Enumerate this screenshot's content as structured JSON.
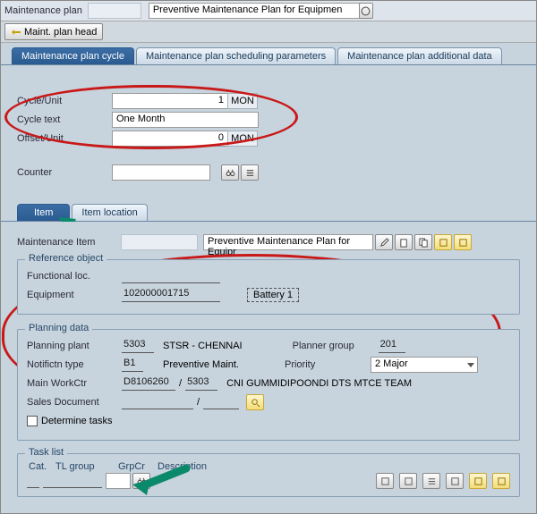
{
  "header": {
    "plan_lbl": "Maintenance plan",
    "plan_code": "",
    "plan_desc": "Preventive Maintenance Plan for Equipmen",
    "head_btn": "Maint. plan head"
  },
  "tabs_main": {
    "cycle": "Maintenance plan cycle",
    "sched": "Maintenance plan scheduling parameters",
    "addl": "Maintenance plan additional data"
  },
  "cycle": {
    "cycle_unit_lbl": "Cycle/Unit",
    "cycle_val": "1",
    "cycle_unit": "MON",
    "cycle_text_lbl": "Cycle text",
    "cycle_text": "One Month",
    "offset_lbl": "Offset/Unit",
    "offset_val": "0",
    "offset_unit": "MON",
    "counter_lbl": "Counter",
    "counter_val": ""
  },
  "tabs_item": {
    "item": "Item",
    "item_loc": "Item location"
  },
  "maint_item": {
    "lbl": "Maintenance Item",
    "code": "",
    "desc": "Preventive Maintenance Plan for Equipr"
  },
  "ref": {
    "title": "Reference object",
    "funcloc_lbl": "Functional loc.",
    "funcloc": "",
    "equip_lbl": "Equipment",
    "equip": "102000001715",
    "equip_desc": "Battery 1"
  },
  "plan": {
    "title": "Planning data",
    "plant_lbl": "Planning plant",
    "plant": "5303",
    "plant_desc": "STSR - CHENNAI",
    "pgroup_lbl": "Planner group",
    "pgroup": "201",
    "ntype_lbl": "Notifictn type",
    "ntype": "B1",
    "ntype_desc": "Preventive Maint.",
    "prio_lbl": "Priority",
    "prio": "2 Major",
    "wctr_lbl": "Main WorkCtr",
    "wctr": "D8106260",
    "wctr_plant": "5303",
    "wctr_desc": "CNI GUMMIDIPOONDI DTS MTCE TEAM",
    "sdoc_lbl": "Sales Document",
    "sdoc": "",
    "sdoc_item": "",
    "det_tasks": "Determine tasks",
    "slash": "/"
  },
  "task": {
    "title": "Task list",
    "cat": "Cat.",
    "group": "TL group",
    "grpcr": "GrpCr",
    "desc": "Description"
  },
  "icons": {
    "edit": "edit",
    "new": "new",
    "copy": "copy",
    "y1": "y1",
    "y2": "y2",
    "binoc": "binoculars",
    "list": "list"
  }
}
